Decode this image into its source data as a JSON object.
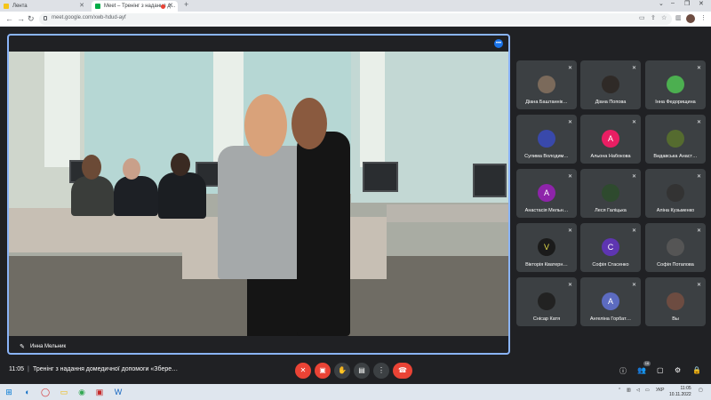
{
  "browser": {
    "tabs": [
      {
        "label": "Лента",
        "active": false
      },
      {
        "label": "Meet – Тренінг з надання д…",
        "active": true
      }
    ],
    "new_tab": "+",
    "url": "meet.google.com/xwb-hdud-ayf"
  },
  "meet": {
    "main_speaker": "Инна Мельник",
    "participants": [
      {
        "name": "Діана Баштаннік…",
        "initial": "",
        "color": "#7b6a5b"
      },
      {
        "name": "Діана Попова",
        "initial": "",
        "color": "#2f2a27"
      },
      {
        "name": "Інна Федорищина",
        "initial": "",
        "color": "#4caf50"
      },
      {
        "name": "Сулима Володим…",
        "initial": "",
        "color": "#3949ab"
      },
      {
        "name": "Альона Набокова",
        "initial": "А",
        "color": "#e91e63"
      },
      {
        "name": "Видавська Анаст…",
        "initial": "",
        "color": "#556b2f"
      },
      {
        "name": "Анастасія Мельн…",
        "initial": "А",
        "color": "#8e24aa"
      },
      {
        "name": "Леся Галіцька",
        "initial": "",
        "color": "#2e4a2e"
      },
      {
        "name": "Аліна Кузьменко",
        "initial": "",
        "color": "#333333"
      },
      {
        "name": "Вікторія Кватерн…",
        "initial": "V",
        "color": "#1b1b1b"
      },
      {
        "name": "Софія Стасенко",
        "initial": "С",
        "color": "#5e35b1"
      },
      {
        "name": "Софія Потапова",
        "initial": "",
        "color": "#555555"
      },
      {
        "name": "Снісар Катя",
        "initial": "",
        "color": "#222222"
      },
      {
        "name": "Ангеліна Горбат…",
        "initial": "А",
        "color": "#5c6bc0"
      },
      {
        "name": "Вы",
        "initial": "",
        "color": "#6d4c41"
      }
    ],
    "time": "11:05",
    "separator": "|",
    "meeting_title": "Тренінг з надання домедичної допомоги «Збере…",
    "participant_count": "16"
  },
  "taskbar": {
    "language": "УКР",
    "clock_time": "11:05",
    "clock_date": "10.11.2022"
  }
}
